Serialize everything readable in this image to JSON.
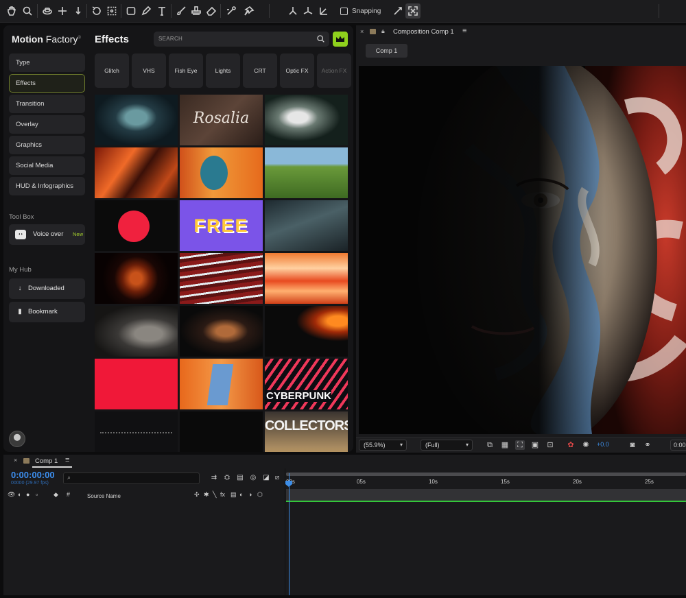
{
  "toolbar": {
    "tools": [
      "hand-tool",
      "zoom-tool",
      "orbit-camera-tool",
      "pan-behind-tool",
      "track-camera-tool",
      "rotate-tool",
      "anchor-point-tool",
      "rectangle-tool",
      "pen-tool",
      "type-tool",
      "brush-tool",
      "clone-stamp-tool",
      "eraser-tool",
      "roto-brush-tool",
      "puppet-pin-tool"
    ],
    "snapping_label": "Snapping"
  },
  "motion_factory": {
    "brand_bold": "Motion",
    "brand_rest": "Factory",
    "categories": [
      "Type",
      "Effects",
      "Transition",
      "Overlay",
      "Graphics",
      "Social Media",
      "HUD & Infographics"
    ],
    "active_category": "Effects",
    "toolbox_label": "Tool Box",
    "voice_over_label": "Voice over",
    "new_badge": "New",
    "myhub_label": "My Hub",
    "downloaded_label": "Downloaded",
    "bookmark_label": "Bookmark",
    "panel_title": "Effects",
    "search_placeholder": "SEARCH",
    "filter_chips": [
      "Glitch",
      "VHS",
      "Fish Eye",
      "Lights",
      "CRT",
      "Optic FX",
      "Action FX"
    ],
    "thumbnail_texts": {
      "rosalia": "Rosalia",
      "free": "FREE",
      "cyberpunk": "CYBERPUNK",
      "collectors": "COLLECTORS"
    }
  },
  "composition": {
    "header_title": "Composition Comp 1",
    "tab_label": "Comp 1",
    "zoom_value": "(55.9%)",
    "resolution_value": "(Full)",
    "exposure_value": "+0.0",
    "timecode_value": "0:00:"
  },
  "timeline": {
    "tab_label": "Comp 1",
    "current_time": "0:00:00:00",
    "frame_info": "00000 (29.97 fps)",
    "source_name_header": "Source Name",
    "ruler_labels": [
      "00s",
      "05s",
      "10s",
      "15s",
      "20s",
      "25s"
    ]
  },
  "colors": {
    "accent_green": "#8fd11d",
    "timecode_blue": "#3c8eee",
    "track_green": "#34c73a"
  }
}
